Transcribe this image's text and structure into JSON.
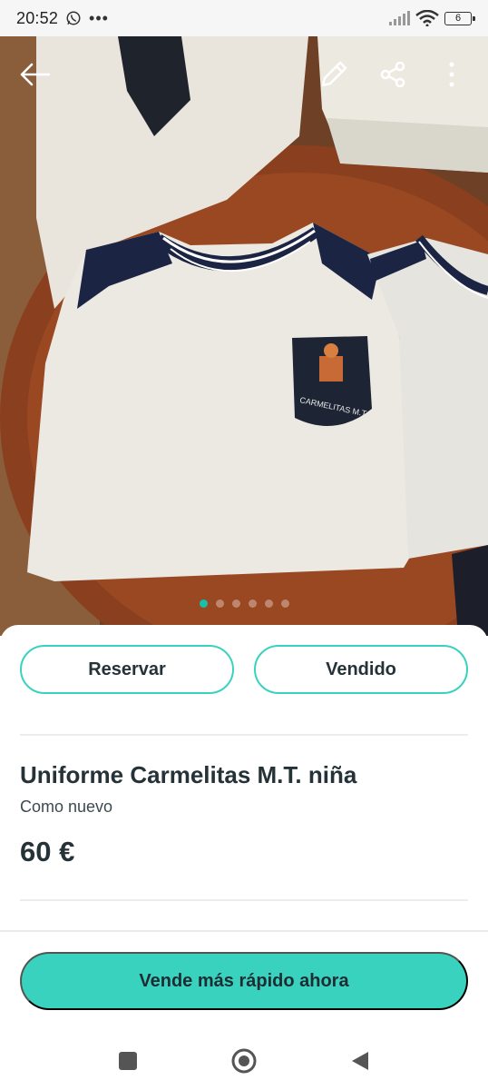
{
  "status_bar": {
    "time": "20:52",
    "battery_level": "6",
    "icons": [
      "whatsapp-icon",
      "more-dots-icon",
      "signal-icon",
      "wifi-icon",
      "battery-icon"
    ]
  },
  "toolbar": {
    "icons": [
      "back-arrow-icon",
      "edit-pencil-icon",
      "share-icon",
      "more-vert-icon"
    ]
  },
  "gallery": {
    "image_count": 6,
    "active_index": 0,
    "crest_text": "CARMELITAS M.T."
  },
  "actions": {
    "reserve_label": "Reservar",
    "sold_label": "Vendido"
  },
  "product": {
    "title": "Uniforme Carmelitas M.T. niña",
    "condition": "Como nuevo",
    "price": "60 €"
  },
  "cta": {
    "label": "Vende más rápido ahora"
  },
  "nav": {
    "icons": [
      "recents-square-icon",
      "home-circle-icon",
      "back-triangle-icon"
    ]
  },
  "colors": {
    "accent": "#38d2be",
    "accent_active_dot": "#13c1ac",
    "text": "#253238"
  }
}
